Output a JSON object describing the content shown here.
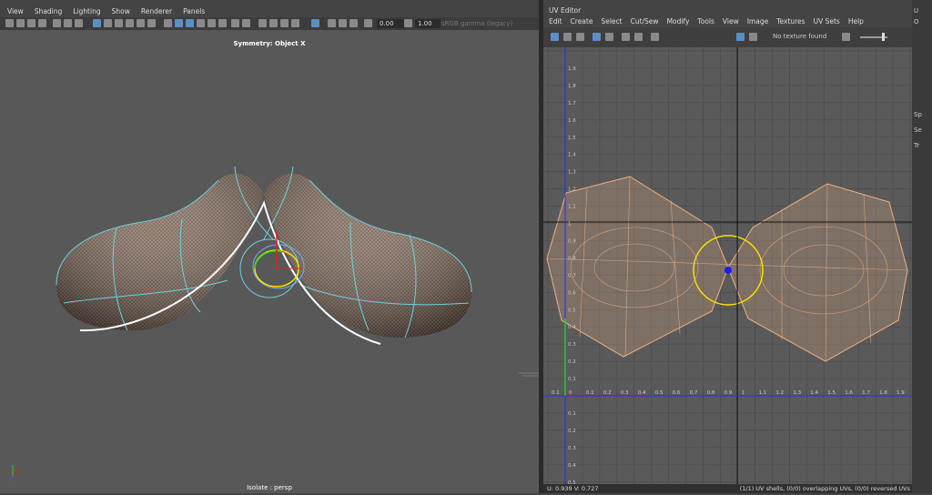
{
  "viewport": {
    "menu": [
      "View",
      "Shading",
      "Lighting",
      "Show",
      "Renderer",
      "Panels"
    ],
    "exposure_value": "0.00",
    "gamma_value": "1.00",
    "color_space": "sRGB gamma (legacy)",
    "symmetry_label": "Symmetry: Object X",
    "camera_label": "Isolate : persp"
  },
  "uv_editor": {
    "title": "UV Editor",
    "menu": [
      "Edit",
      "Create",
      "Select",
      "Cut/Sew",
      "Modify",
      "Tools",
      "View",
      "Image",
      "Textures",
      "UV Sets",
      "Help"
    ],
    "texture_status": "No texture found",
    "x_ticks": [
      "0.1",
      "0",
      "0.1",
      "0.2",
      "0.3",
      "0.4",
      "0.5",
      "0.6",
      "0.7",
      "0.8",
      "0.9",
      "1",
      "1.1",
      "1.2",
      "1.3",
      "1.4",
      "1.5",
      "1.6",
      "1.7",
      "1.8",
      "1.9"
    ],
    "y_ticks": [
      "1.9",
      "1.8",
      "1.7",
      "1.6",
      "1.5",
      "1.4",
      "1.3",
      "1.2",
      "1.1",
      "1",
      "0.9",
      "0.8",
      "0.7",
      "0.6",
      "0.5",
      "0.4",
      "0.3",
      "0.2",
      "0.1"
    ],
    "y_ticks_neg": [
      "0.1",
      "0.2",
      "0.3",
      "0.4",
      "0.5"
    ],
    "coords": "U:  0.939  V:  0.727",
    "shell_info": "(1/1) UV shells, (0/0) overlapping UVs, (0/0) reversed UVs"
  },
  "right_panel": {
    "letters": [
      "U",
      "O",
      "Sp",
      "Se",
      "Tr"
    ]
  },
  "colors": {
    "viewport_bg": "#585858",
    "uv_shell": "#f0b080",
    "selection": "#ffe000",
    "axis_blue": "#1a1aff",
    "axis_red": "#e02020",
    "axis_green": "#20d020"
  }
}
